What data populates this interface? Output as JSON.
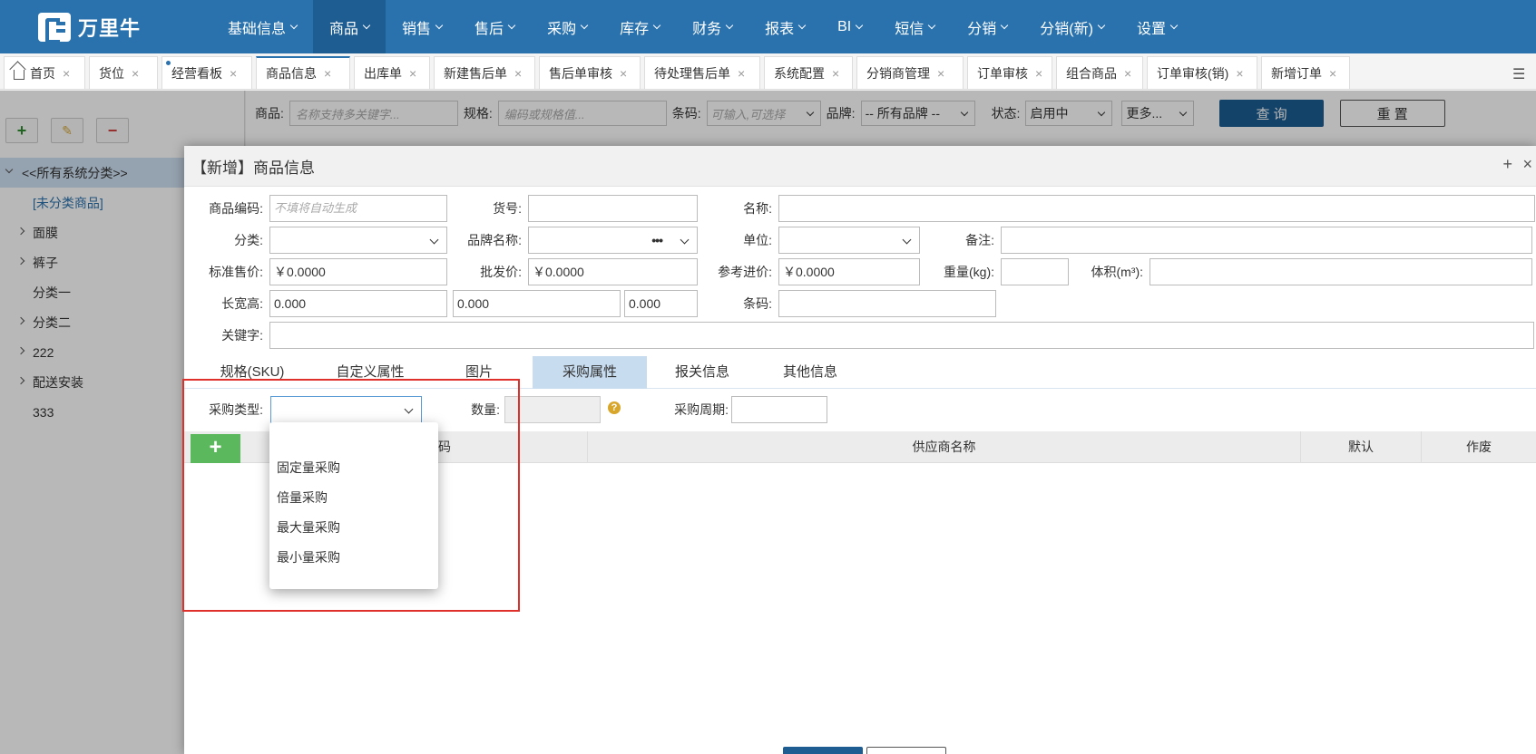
{
  "brand": {
    "name": "万里牛"
  },
  "nav": {
    "items": [
      {
        "label": "基础信息",
        "active": false
      },
      {
        "label": "商品",
        "active": true
      },
      {
        "label": "销售",
        "active": false
      },
      {
        "label": "售后",
        "active": false
      },
      {
        "label": "采购",
        "active": false
      },
      {
        "label": "库存",
        "active": false
      },
      {
        "label": "财务",
        "active": false
      },
      {
        "label": "报表",
        "active": false
      },
      {
        "label": "BI",
        "active": false
      },
      {
        "label": "短信",
        "active": false
      },
      {
        "label": "分销",
        "active": false
      },
      {
        "label": "分销(新)",
        "active": false
      },
      {
        "label": "设置",
        "active": false
      }
    ]
  },
  "tabs": [
    {
      "label": "首页"
    },
    {
      "label": "货位"
    },
    {
      "label": "经营看板"
    },
    {
      "label": "商品信息"
    },
    {
      "label": "出库单"
    },
    {
      "label": "新建售后单"
    },
    {
      "label": "售后单审核"
    },
    {
      "label": "待处理售后单"
    },
    {
      "label": "系统配置"
    },
    {
      "label": "分销商管理"
    },
    {
      "label": "订单审核"
    },
    {
      "label": "组合商品"
    },
    {
      "label": "订单审核(销)"
    },
    {
      "label": "新增订单"
    }
  ],
  "tree": {
    "root": "<<所有系统分类>>",
    "items": [
      {
        "label": "[未分类商品]",
        "expandable": false
      },
      {
        "label": "面膜",
        "expandable": true
      },
      {
        "label": "裤子",
        "expandable": true
      },
      {
        "label": "分类一",
        "expandable": false
      },
      {
        "label": "分类二",
        "expandable": true
      },
      {
        "label": "222",
        "expandable": true
      },
      {
        "label": "配送安装",
        "expandable": true
      },
      {
        "label": "333",
        "expandable": false
      }
    ]
  },
  "search": {
    "goods_label": "商品:",
    "goods_placeholder": "名称支持多关键字...",
    "spec_label": "规格:",
    "spec_placeholder": "编码或规格值...",
    "barcode_label": "条码:",
    "barcode_placeholder": "可输入,可选择",
    "brand_label": "品牌:",
    "brand_value": "-- 所有品牌 --",
    "status_label": "状态:",
    "status_value": "启用中",
    "more_label": "更多...",
    "query_button": "查 询",
    "reset_button": "重 置"
  },
  "modal": {
    "title": "【新增】商品信息",
    "form": {
      "code_label": "商品编码:",
      "code_placeholder": "不填将自动生成",
      "item_no_label": "货号:",
      "name_label": "名称:",
      "category_label": "分类:",
      "brand_label": "品牌名称:",
      "unit_label": "单位:",
      "remark_label": "备注:",
      "std_price_label": "标准售价:",
      "std_price_value": "￥0.0000",
      "wholesale_label": "批发价:",
      "wholesale_value": "￥0.0000",
      "ref_price_label": "参考进价:",
      "ref_price_value": "￥0.0000",
      "weight_label": "重量(kg):",
      "volume_label": "体积(m³):",
      "dims_label": "长宽高:",
      "length_value": "0.000",
      "width_value": "0.000",
      "height_value": "0.000",
      "barcode_label": "条码:",
      "keyword_label": "关键字:"
    },
    "subtabs": [
      {
        "label": "规格(SKU)",
        "active": false
      },
      {
        "label": "自定义属性",
        "active": false
      },
      {
        "label": "图片",
        "active": false
      },
      {
        "label": "采购属性",
        "active": true
      },
      {
        "label": "报关信息",
        "active": false
      },
      {
        "label": "其他信息",
        "active": false
      }
    ],
    "purchase": {
      "type_label": "采购类型:",
      "qty_label": "数量:",
      "cycle_label": "采购周期:",
      "type_options": [
        "固定量采购",
        "倍量采购",
        "最大量采购",
        "最小量采购"
      ]
    },
    "grid": {
      "columns": [
        "码",
        "供应商名称",
        "默认",
        "作废"
      ]
    }
  }
}
